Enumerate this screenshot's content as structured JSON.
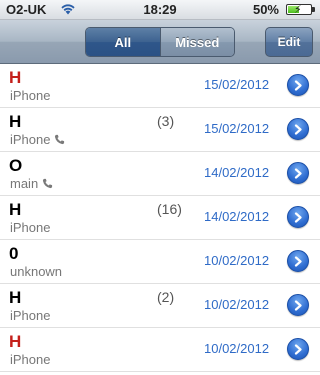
{
  "status_bar": {
    "carrier": "O2-UK",
    "time": "18:29",
    "battery_percent": "50%",
    "battery_level": 0.5
  },
  "nav_bar": {
    "segments": [
      {
        "label": "All",
        "active": true
      },
      {
        "label": "Missed",
        "active": false
      }
    ],
    "edit_label": "Edit"
  },
  "calls": [
    {
      "name": "H",
      "missed": true,
      "count": "",
      "type": "iPhone",
      "phone_icon": false,
      "date": "15/02/2012"
    },
    {
      "name": "H",
      "missed": false,
      "count": "(3)",
      "type": "iPhone",
      "phone_icon": true,
      "date": "15/02/2012"
    },
    {
      "name": "O",
      "missed": false,
      "count": "",
      "type": "main",
      "phone_icon": true,
      "date": "14/02/2012"
    },
    {
      "name": "H",
      "missed": false,
      "count": "(16)",
      "type": "iPhone",
      "phone_icon": false,
      "date": "14/02/2012"
    },
    {
      "name": "0",
      "missed": false,
      "count": "",
      "type": "unknown",
      "phone_icon": false,
      "date": "10/02/2012"
    },
    {
      "name": "H",
      "missed": false,
      "count": "(2)",
      "type": "iPhone",
      "phone_icon": false,
      "date": "10/02/2012"
    },
    {
      "name": "H",
      "missed": true,
      "count": "",
      "type": "iPhone",
      "phone_icon": false,
      "date": "10/02/2012"
    }
  ],
  "colors": {
    "missed": "#c4201b",
    "date": "#2f6bc7",
    "nav": "#8a9aad"
  },
  "icons": {
    "wifi": "wifi-icon",
    "battery": "battery-icon",
    "outgoing_call": "phone-icon",
    "detail": "detail-disclosure-icon"
  }
}
